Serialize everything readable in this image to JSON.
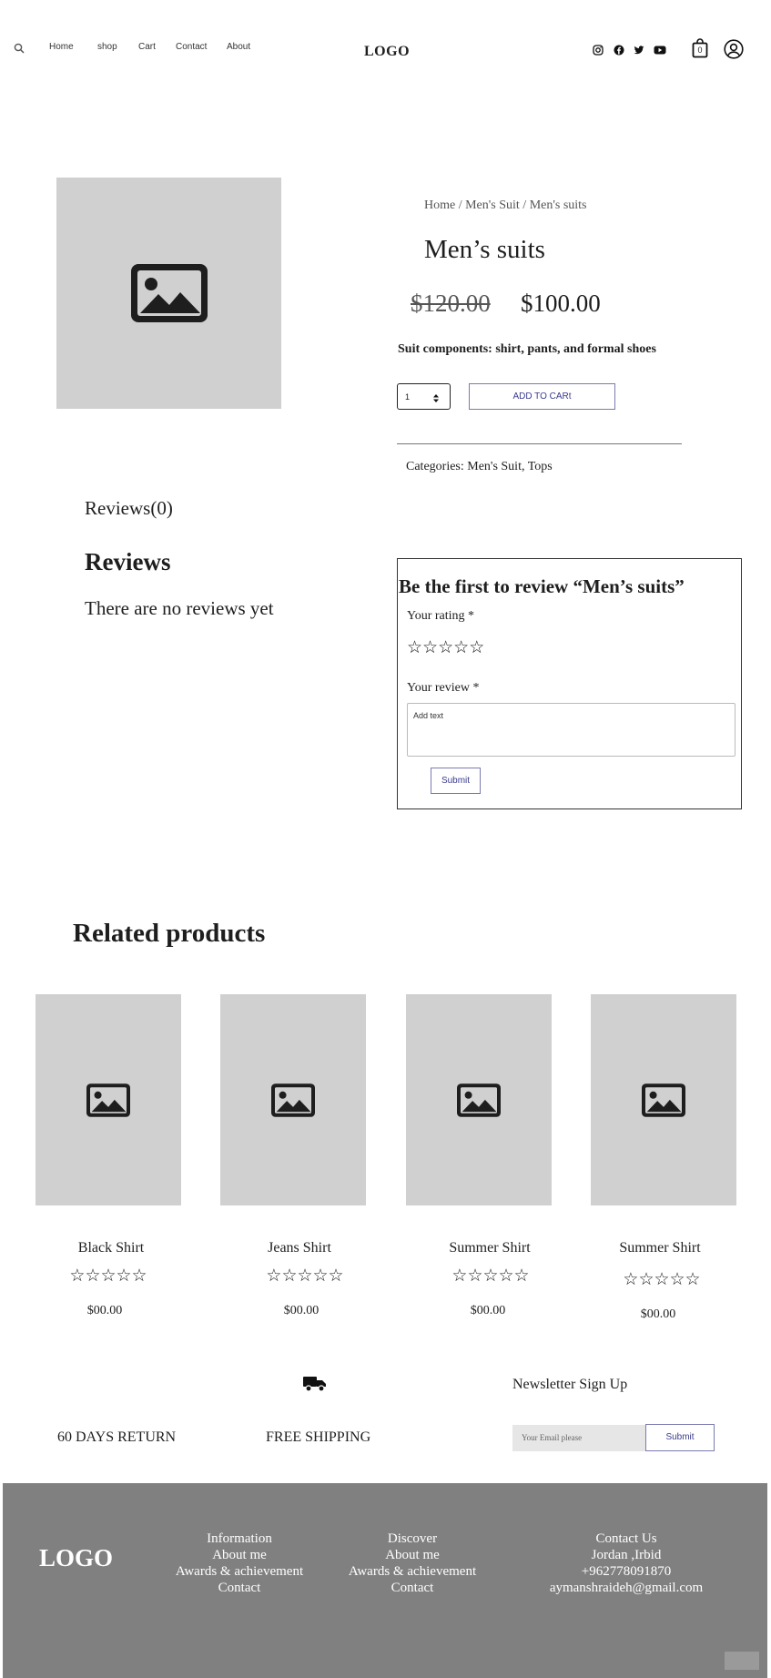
{
  "header": {
    "nav": [
      "Home",
      "shop",
      "Cart",
      "Contact",
      "About"
    ],
    "logo": "LOGO",
    "cart_count": "0",
    "icons": [
      "search-icon",
      "instagram-icon",
      "facebook-icon",
      "twitter-icon",
      "youtube-icon",
      "cart-icon",
      "user-icon"
    ]
  },
  "product": {
    "breadcrumb": "Home / Men's Suit / Men's suits",
    "title": "Men’s suits",
    "old_price": "$120.00",
    "price": "$100.00",
    "description": "Suit components: shirt, pants, and formal shoes",
    "quantity": "1",
    "add_to_cart": "ADD TO CARt",
    "categories": "Categories: Men's Suit, Tops"
  },
  "reviews": {
    "tab": "Reviews(0)",
    "heading": "Reviews",
    "empty": "There are no reviews yet",
    "form_title": "Be the first to review “Men’s suits”",
    "rating_label": "Your rating *",
    "review_label": "Your review *",
    "review_placeholder": "Add text",
    "submit": "Submit"
  },
  "related": {
    "heading": "Related products",
    "items": [
      {
        "name": "Black Shirt",
        "price": "$00.00"
      },
      {
        "name": "Jeans Shirt",
        "price": "$00.00"
      },
      {
        "name": "Summer Shirt",
        "price": "$00.00"
      },
      {
        "name": "Summer Shirt",
        "price": "$00.00"
      }
    ]
  },
  "features": {
    "return": "60 DAYS RETURN",
    "shipping": "FREE SHIPPING",
    "newsletter_title": "Newsletter Sign Up",
    "email_placeholder": "Your Email please",
    "submit": "Submit"
  },
  "footer": {
    "logo": "LOGO",
    "col1": [
      "Information",
      "About me",
      "Awards & achievement",
      "Contact"
    ],
    "col2": [
      "Discover",
      "About me",
      "Awards & achievement",
      "Contact"
    ],
    "col3": [
      "Contact Us",
      "Jordan ,Irbid",
      "+962778091870",
      "aymanshraideh@gmail.com"
    ]
  },
  "colors": {
    "placeholder_bg": "#d0d0d0",
    "footer_bg": "#808080",
    "button_accent": "#3b3b8f"
  }
}
